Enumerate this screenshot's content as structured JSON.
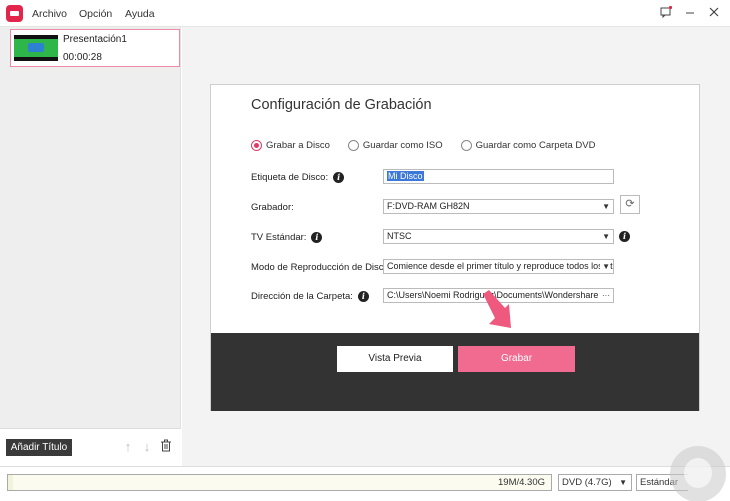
{
  "menu": {
    "archivo": "Archivo",
    "opcion": "Opción",
    "ayuda": "Ayuda"
  },
  "window": {
    "icons": [
      "feedback-icon",
      "minimize-icon",
      "close-icon"
    ],
    "notification_badge_color": "#e2254b"
  },
  "clip": {
    "name": "Presentación1",
    "duration": "00:00:28"
  },
  "left_bottom": {
    "add_title_label": "Añadir Título"
  },
  "dialog": {
    "title": "Configuración de Grabación",
    "radio_options": [
      {
        "label": "Grabar a Disco",
        "selected": true
      },
      {
        "label": "Guardar como ISO",
        "selected": false
      },
      {
        "label": "Guardar como Carpeta DVD",
        "selected": false
      }
    ],
    "fields": {
      "disc_label": {
        "label": "Etiqueta de Disco:",
        "value": "Mi Disco"
      },
      "burner": {
        "label": "Grabador:",
        "value": "F:DVD-RAM GH82N"
      },
      "tv_standard": {
        "label": "TV Estándar:",
        "value": "NTSC"
      },
      "playback_mode": {
        "label": "Modo de Reproducción de Disco:",
        "value": "Comience desde el primer título y reproduce todos los tít"
      },
      "folder_path": {
        "label": "Dirección de la Carpeta:",
        "value": "C:\\Users\\Noemi Rodriguez\\Documents\\Wondershare D",
        "browse": "···"
      }
    },
    "preview_button": "Vista Previa",
    "burn_button": "Grabar",
    "accent_color": "#f06b8f"
  },
  "status": {
    "capacity_text": "19M/4.30G",
    "capacity_used": 0.0044,
    "disc_type": "DVD (4.7G)",
    "quality": "Estándar"
  }
}
